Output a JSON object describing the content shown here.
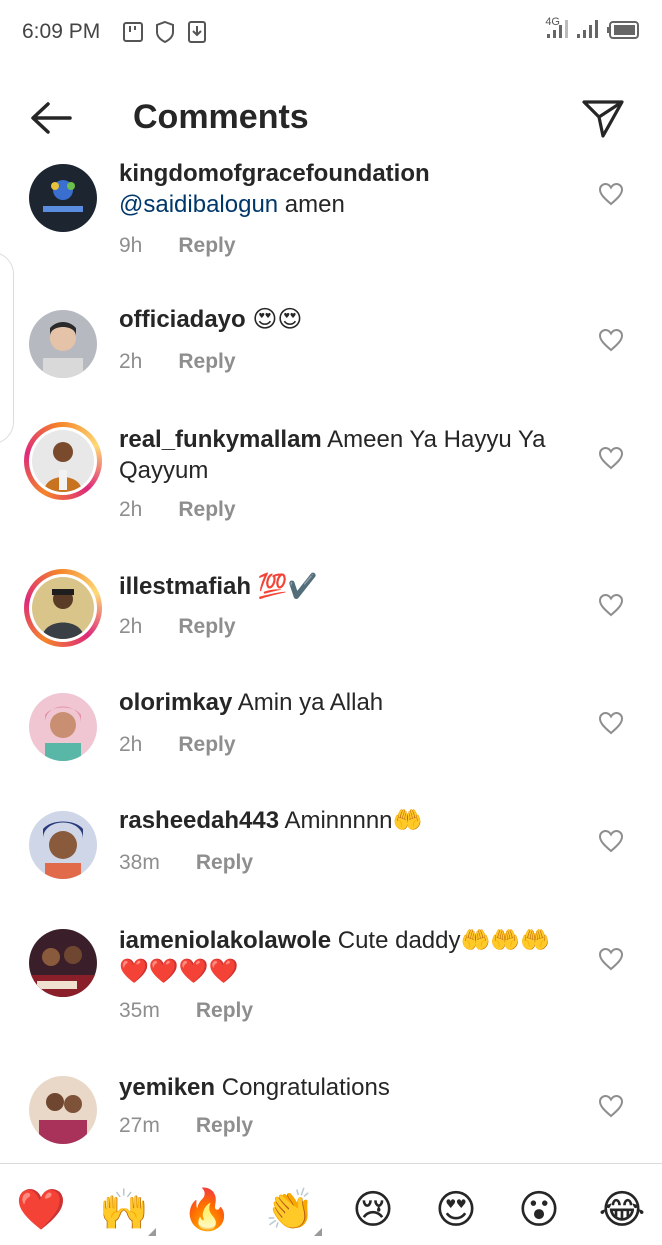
{
  "status_bar": {
    "time": "6:09 PM",
    "network": "4G"
  },
  "header": {
    "title": "Comments"
  },
  "comments": [
    {
      "username": "kingdomofgracefoundation",
      "mention": "@saidibalogun",
      "text": " amen",
      "time": "9h",
      "reply": "Reply"
    },
    {
      "username": "officiadayo",
      "mention": "",
      "text": " 😍😍",
      "time": "2h",
      "reply": "Reply"
    },
    {
      "username": "real_funkymallam",
      "mention": "",
      "text": " Ameen Ya Hayyu Ya Qayyum",
      "time": "2h",
      "reply": "Reply"
    },
    {
      "username": "illestmafiah",
      "mention": "",
      "text": " 💯✔️",
      "time": "2h",
      "reply": "Reply"
    },
    {
      "username": "olorimkay",
      "mention": "",
      "text": " Amin ya Allah",
      "time": "2h",
      "reply": "Reply"
    },
    {
      "username": "rasheedah443",
      "mention": "",
      "text": " Aminnnnn🤲",
      "time": "38m",
      "reply": "Reply"
    },
    {
      "username": "iameniolakolawole",
      "mention": "",
      "text": " Cute daddy🤲🤲🤲❤️❤️❤️❤️",
      "time": "35m",
      "reply": "Reply"
    },
    {
      "username": "yemiken",
      "mention": "",
      "text": " Congratulations",
      "time": "27m",
      "reply": "Reply"
    }
  ],
  "emoji_bar": [
    "❤️",
    "🙌",
    "🔥",
    "👏",
    "😢",
    "😍",
    "😮",
    "😂"
  ],
  "icons": {
    "back": "arrow-left-icon",
    "direct": "paper-plane-icon",
    "like": "heart-outline-icon"
  },
  "colors": {
    "mention": "#00376b",
    "secondary_text": "#8e8e8e",
    "heart": "#e0245e"
  }
}
